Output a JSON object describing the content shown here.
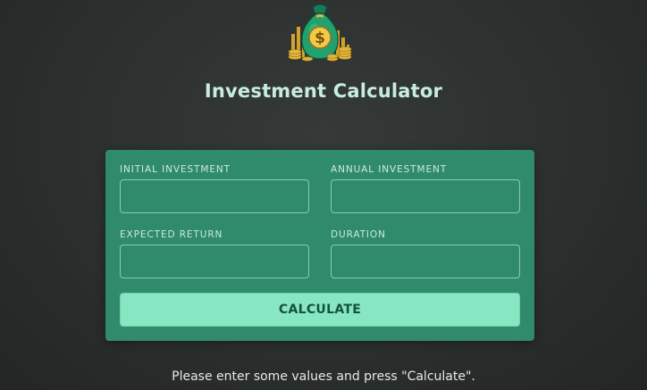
{
  "header": {
    "logo_icon": "money-bag-dollar-icon",
    "title": "Investment Calculator"
  },
  "form": {
    "initial_investment": {
      "label": "INITIAL INVESTMENT",
      "value": ""
    },
    "annual_investment": {
      "label": "ANNUAL INVESTMENT",
      "value": ""
    },
    "expected_return": {
      "label": "EXPECTED RETURN",
      "value": ""
    },
    "duration": {
      "label": "DURATION",
      "value": ""
    },
    "calculate_label": "CALCULATE"
  },
  "message": "Please enter some values and press \"Calculate\".",
  "colors": {
    "background": "#2d312f",
    "card": "#2f8b6b",
    "button": "#86e7c2",
    "title": "#c8ede0"
  }
}
